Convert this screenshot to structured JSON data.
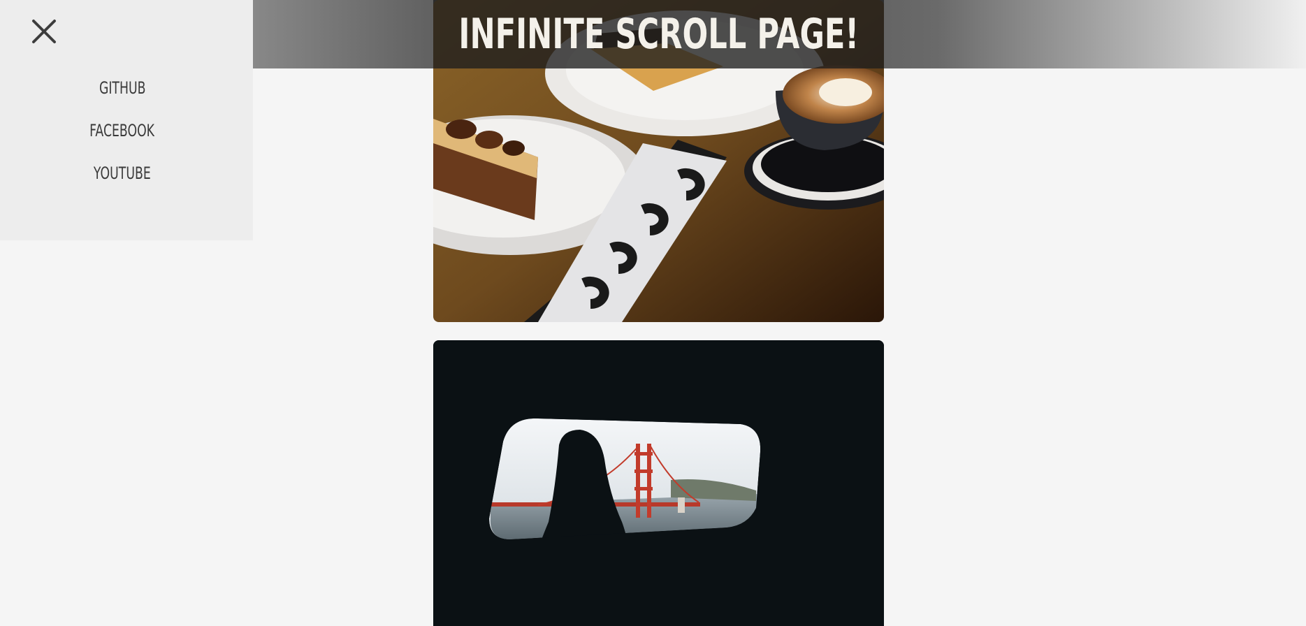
{
  "header": {
    "title": "INFINITE SCROLL PAGE!"
  },
  "side_menu": {
    "close_icon": "close-icon",
    "items": [
      {
        "label": "GITHUB"
      },
      {
        "label": "FACEBOOK"
      },
      {
        "label": "YOUTUBE"
      }
    ]
  },
  "feed": {
    "images": [
      {
        "subject": "pastries-and-latte-on-table"
      },
      {
        "subject": "golden-gate-bridge-through-car-window"
      }
    ]
  },
  "colors": {
    "background": "#f5f5f5",
    "menu_background": "#ededed",
    "menu_text": "#3a3a3a",
    "title_text": "#f4f1ea"
  }
}
